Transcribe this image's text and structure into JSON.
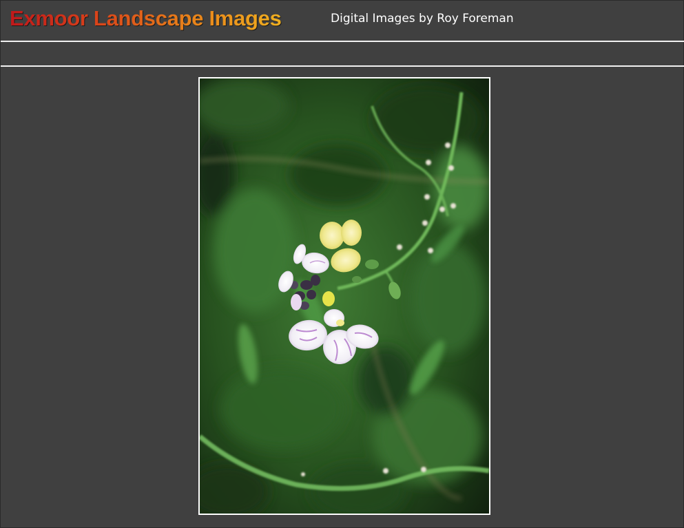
{
  "header": {
    "title": "Exmoor Landscape Images",
    "subtitle": "Digital Images by Roy Foreman"
  },
  "main": {
    "photo": {
      "subject": "flower-photo"
    }
  },
  "colors": {
    "background": "#404040",
    "rule": "#f2f2f2",
    "title_gradient_start": "#c0181a",
    "title_gradient_end": "#f0b020",
    "subtitle": "#ffffff",
    "frame_border": "#ffffff"
  }
}
